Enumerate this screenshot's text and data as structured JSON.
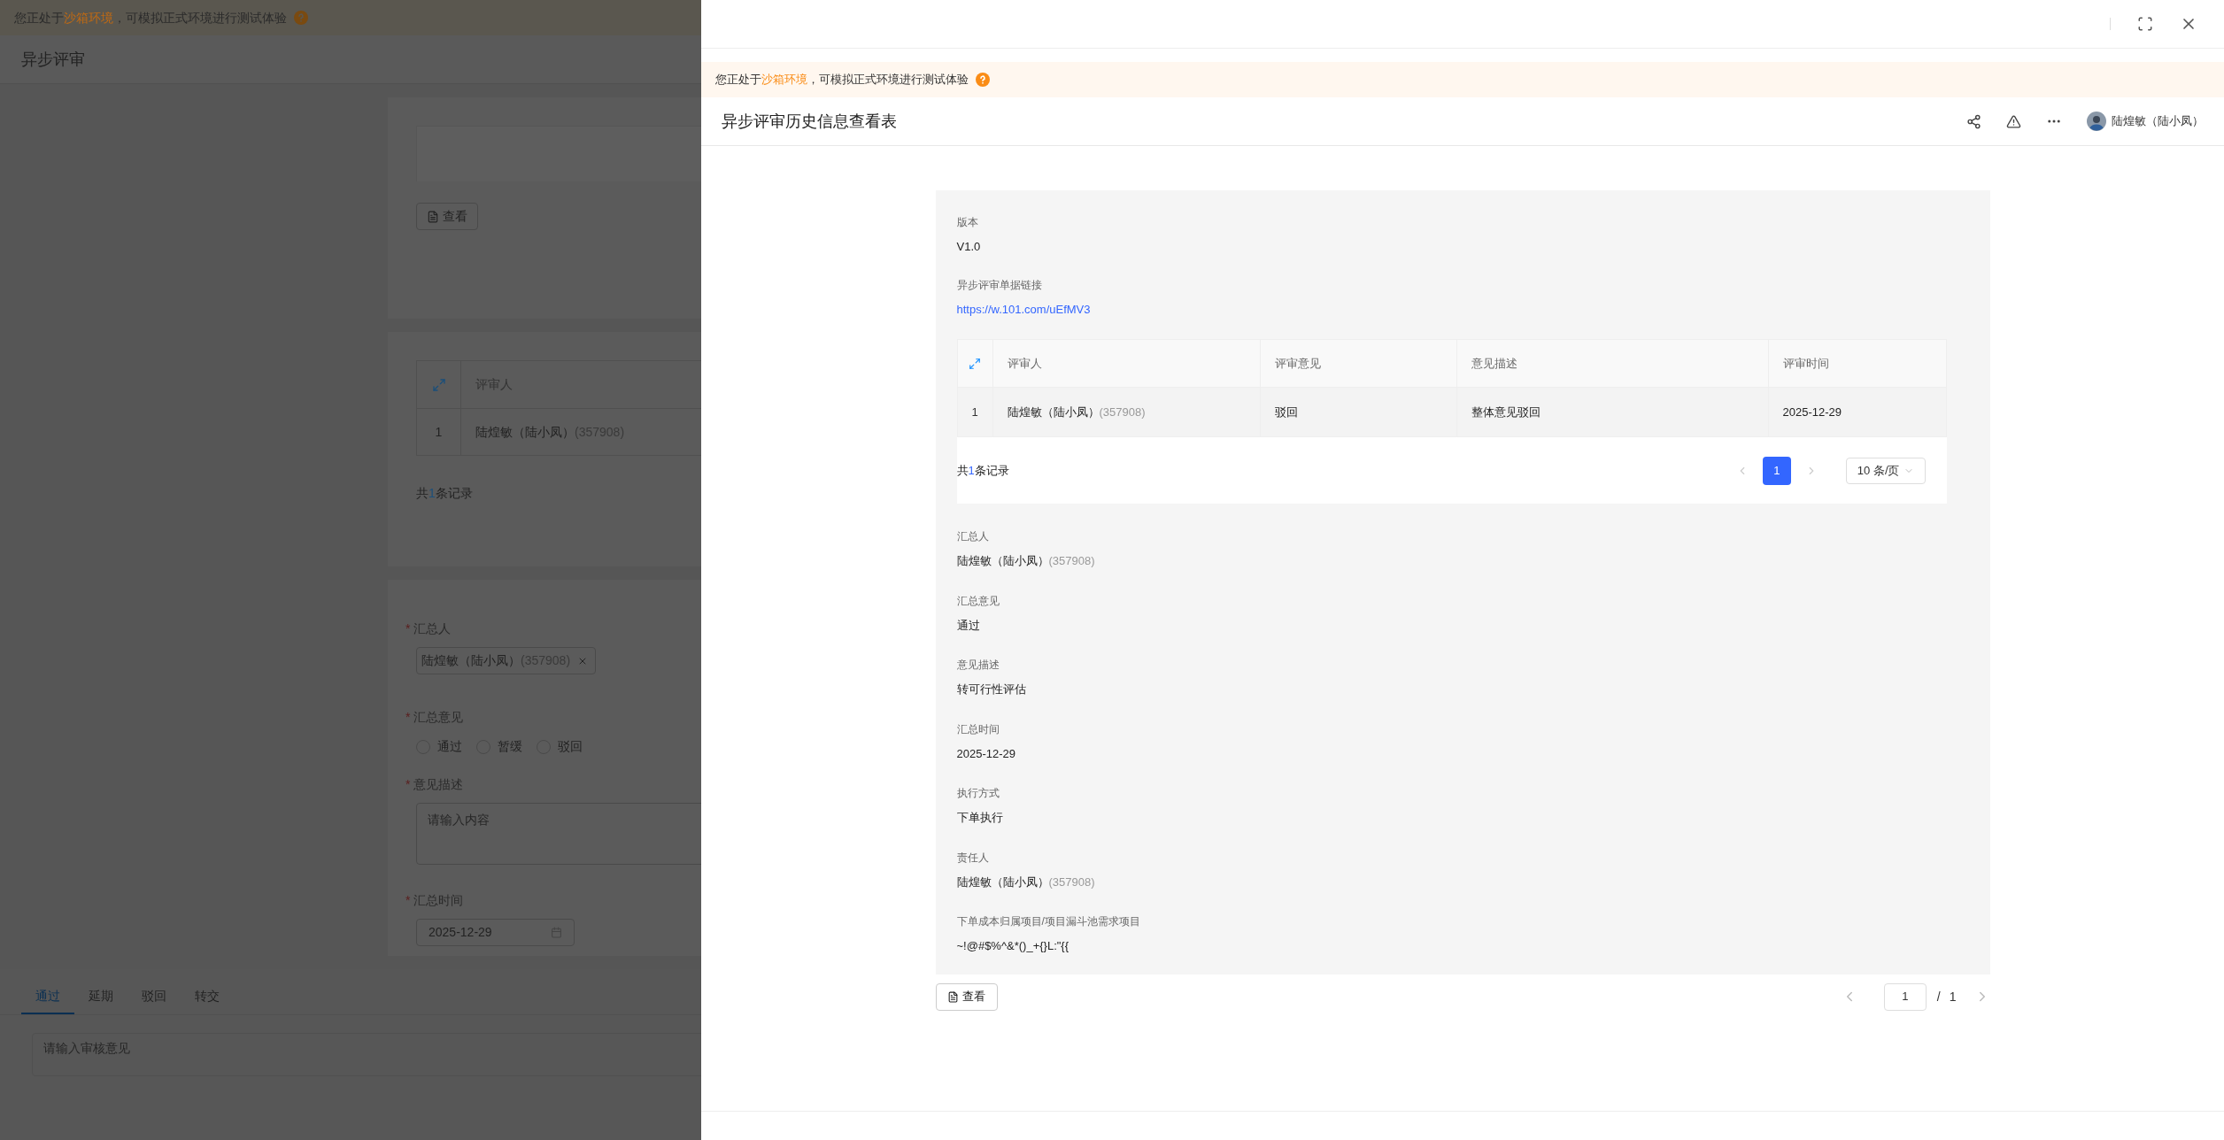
{
  "background": {
    "sandbox_notice": {
      "before": "您正处于",
      "highlight": "沙箱环境",
      "after": "，可模拟正式环境进行测试体验"
    },
    "page_title": "异步评审",
    "view_button": "查看",
    "reviewer_table": {
      "columns": [
        "评审人"
      ],
      "rows": [
        {
          "index": "1",
          "name": "陆煌敏（陆小凤）",
          "id": "(357908)"
        }
      ]
    },
    "total": {
      "before": "共",
      "count": "1",
      "after": "条记录"
    },
    "form": {
      "summarizer": {
        "mark": "*",
        "label": "汇总人",
        "name": "陆煌敏（陆小凤）",
        "id": "(357908)"
      },
      "opinion": {
        "mark": "*",
        "label": "汇总意见",
        "options": [
          {
            "label": "通过",
            "selected": false
          },
          {
            "label": "暂缓",
            "selected": false
          },
          {
            "label": "驳回",
            "selected": false
          }
        ]
      },
      "description": {
        "mark": "*",
        "label": "意见描述",
        "placeholder": "请输入内容"
      },
      "time": {
        "mark": "*",
        "label": "汇总时间",
        "value": "2025-12-29"
      }
    },
    "tabs": [
      {
        "label": "通过",
        "selected": true
      },
      {
        "label": "延期",
        "selected": false
      },
      {
        "label": "驳回",
        "selected": false
      },
      {
        "label": "转交",
        "selected": false
      }
    ],
    "comment": {
      "placeholder": "请输入审核意见"
    }
  },
  "drawer": {
    "sandbox_notice": {
      "before": "您正处于",
      "highlight": "沙箱环境",
      "after": "，可模拟正式环境进行测试体验"
    },
    "title": "异步评审历史信息查看表",
    "user": "陆煌敏（陆小凤）",
    "top_fields": [
      {
        "label": "版本",
        "kind": "text",
        "value": "V1.0"
      },
      {
        "label": "异步评审单据链接",
        "kind": "link",
        "value": "https://w.101.com/uEfMV3"
      }
    ],
    "table": {
      "columns": [
        "评审人",
        "评审意见",
        "意见描述",
        "评审时间"
      ],
      "rows": [
        {
          "index": "1",
          "cells": [
            {
              "name": "陆煌敏（陆小凤）",
              "id": "(357908)"
            },
            {
              "text": "驳回"
            },
            {
              "text": "整体意见驳回"
            },
            {
              "text": "2025-12-29"
            }
          ]
        }
      ],
      "total": {
        "before": "共",
        "count": "1",
        "after": "条记录"
      },
      "pages": [
        {
          "label": "1",
          "selected": true
        }
      ],
      "page_size": "10 条/页"
    },
    "fields": [
      {
        "label": "汇总人",
        "kind": "person",
        "name": "陆煌敏（陆小凤）",
        "id": "(357908)"
      },
      {
        "label": "汇总意见",
        "kind": "text",
        "value": "通过"
      },
      {
        "label": "意见描述",
        "kind": "text",
        "value": "转可行性评估"
      },
      {
        "label": "汇总时间",
        "kind": "text",
        "value": "2025-12-29"
      },
      {
        "label": "执行方式",
        "kind": "text",
        "value": "下单执行"
      },
      {
        "label": "责任人",
        "kind": "person",
        "name": "陆煌敏（陆小凤）",
        "id": "(357908)"
      },
      {
        "label": "下单成本归属项目/项目漏斗池需求项目",
        "kind": "text",
        "value": "~!@#$%^&*()_+{}L:\"{{"
      }
    ],
    "view_button": "查看",
    "pager": {
      "page": "1",
      "separator": "/",
      "total": "1"
    }
  }
}
